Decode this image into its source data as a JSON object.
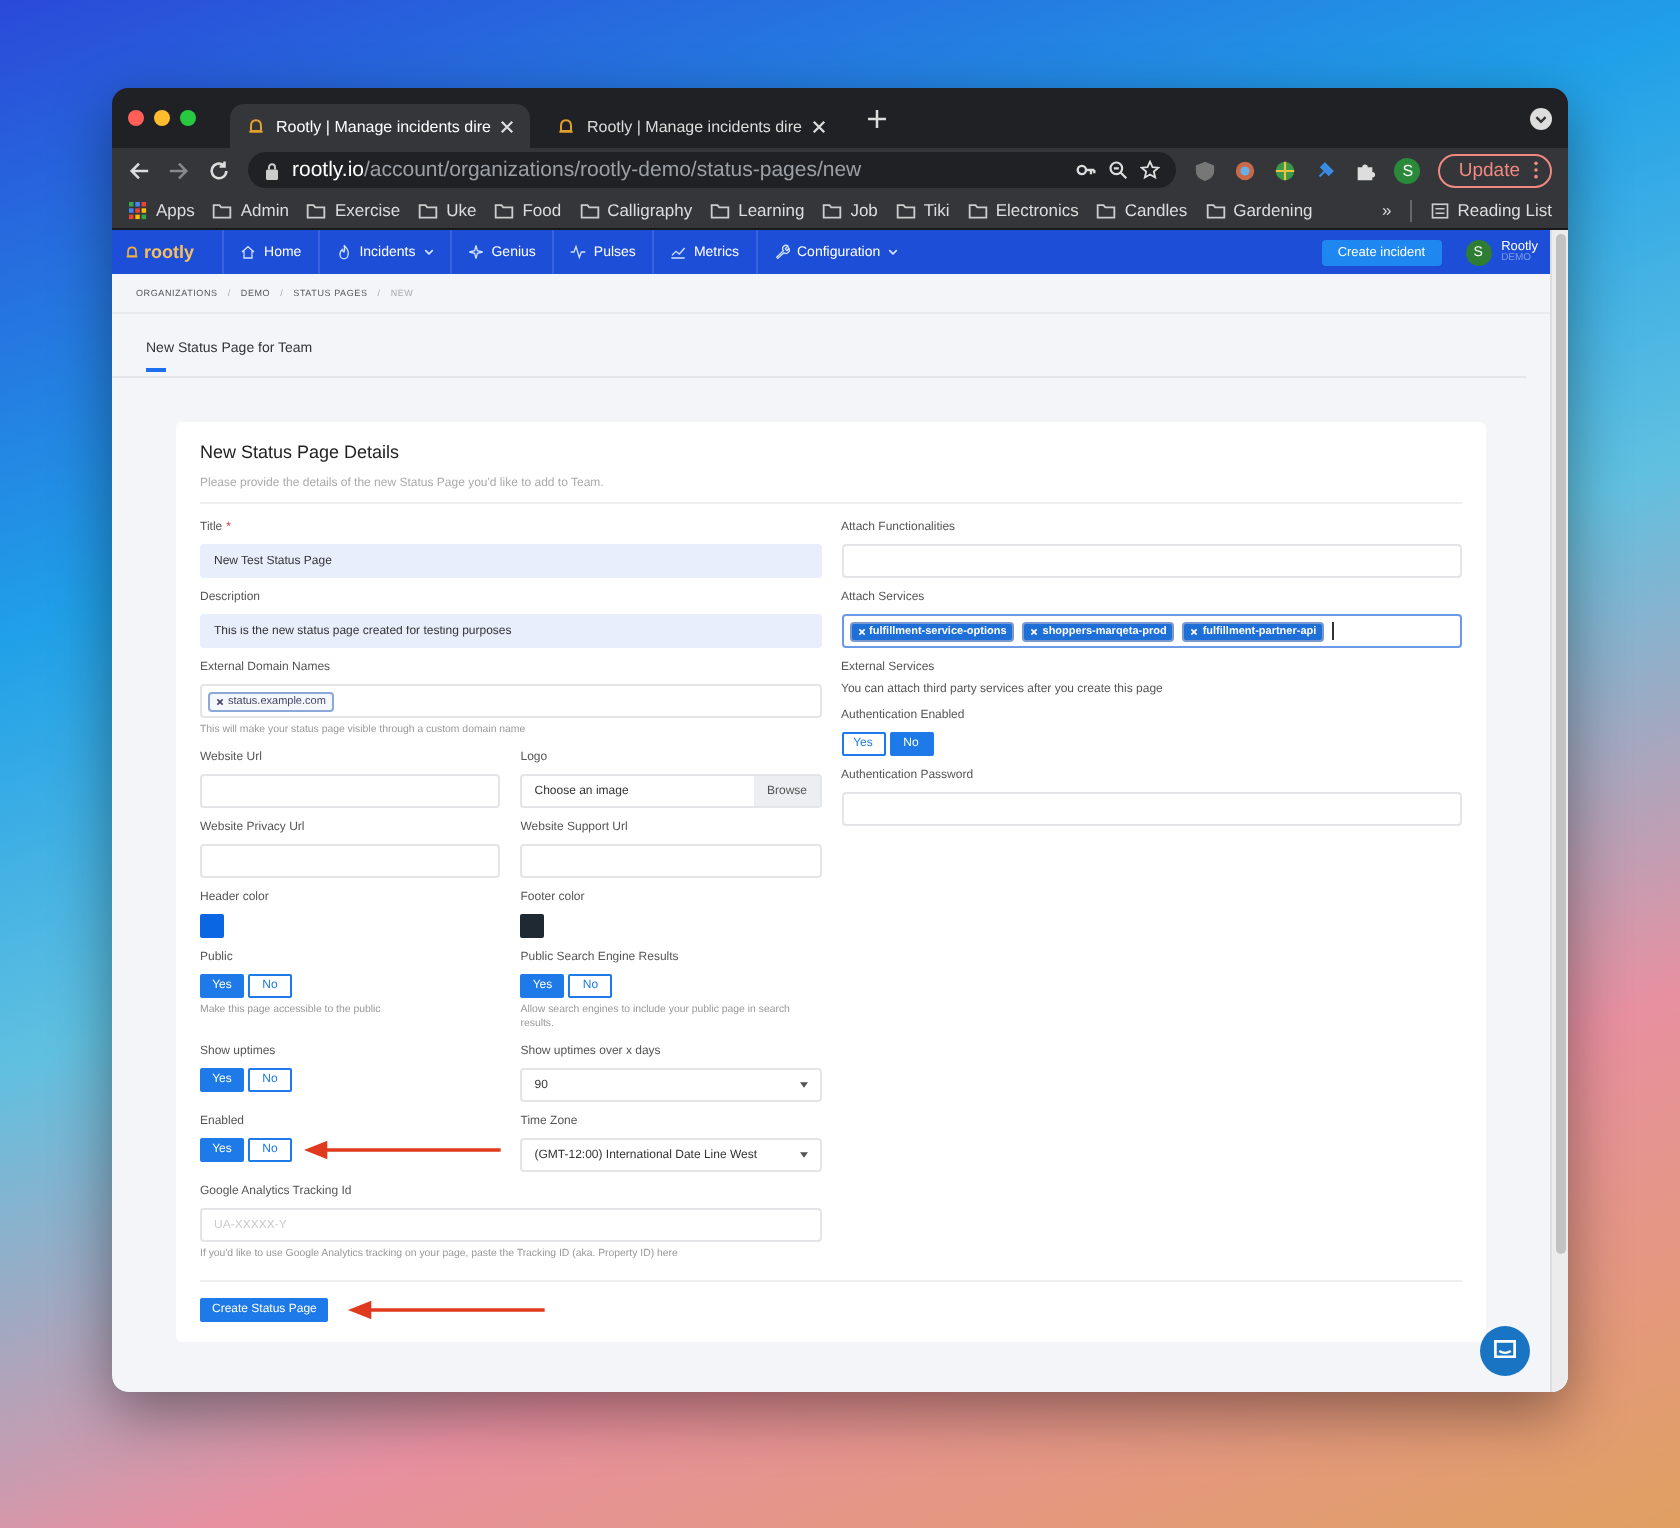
{
  "browser": {
    "tabs": [
      {
        "title": "Rootly | Manage incidents dire",
        "selected": true
      },
      {
        "title": "Rootly | Manage incidents dire",
        "selected": false
      }
    ],
    "url": {
      "host": "rootly.io",
      "path": "/account/organizations/rootly-demo/status-pages/new"
    },
    "profile_initial": "S",
    "update_button": "Update",
    "bookmarks": [
      {
        "kind": "apps",
        "label": "Apps"
      },
      {
        "kind": "folder",
        "label": "Admin"
      },
      {
        "kind": "folder",
        "label": "Exercise"
      },
      {
        "kind": "folder",
        "label": "Uke"
      },
      {
        "kind": "folder",
        "label": "Food"
      },
      {
        "kind": "folder",
        "label": "Calligraphy"
      },
      {
        "kind": "folder",
        "label": "Learning"
      },
      {
        "kind": "folder",
        "label": "Job"
      },
      {
        "kind": "folder",
        "label": "Tiki"
      },
      {
        "kind": "folder",
        "label": "Electronics"
      },
      {
        "kind": "folder",
        "label": "Candles"
      },
      {
        "kind": "folder",
        "label": "Gardening"
      }
    ],
    "more_bookmarks": "»",
    "reading_list": "Reading List"
  },
  "app": {
    "logo": "rootly",
    "nav": [
      {
        "label": "Home",
        "has_menu": false
      },
      {
        "label": "Incidents",
        "has_menu": true
      },
      {
        "label": "Genius",
        "has_menu": false
      },
      {
        "label": "Pulses",
        "has_menu": false
      },
      {
        "label": "Metrics",
        "has_menu": false
      },
      {
        "label": "Configuration",
        "has_menu": true
      }
    ],
    "create_button": "Create incident",
    "user": {
      "initial": "S",
      "name": "Rootly",
      "org": "DEMO"
    },
    "breadcrumbs": [
      "ORGANIZATIONS",
      "DEMO",
      "STATUS PAGES",
      "NEW"
    ],
    "breadcrumb_separator": "/",
    "page_tabs": [
      {
        "label": "New Status Page for Team",
        "selected": true
      }
    ],
    "card": {
      "title": "New Status Page Details",
      "subtitle": "Please provide the details of the new Status Page you'd like to add to Team.",
      "left": [
        {
          "fields": [
            {
              "kind": "text",
              "label": "Title",
              "required_mark": "*",
              "value": "New Test Status Page",
              "filled": true
            }
          ]
        },
        {
          "fields": [
            {
              "kind": "text",
              "label": "Description",
              "value": "This is the new status page created for testing purposes",
              "filled": true
            }
          ]
        },
        {
          "fields": [
            {
              "kind": "tags",
              "label": "External Domain Names",
              "tags": [
                {
                  "label": "status.example.com",
                  "selected": false
                }
              ],
              "focused": false,
              "help": "This will make your status page visible through a custom domain name"
            }
          ]
        },
        {
          "fields": [
            {
              "kind": "text",
              "label": "Website Url",
              "filled": false
            },
            {
              "kind": "file",
              "label": "Logo",
              "placeholder": "Choose an image",
              "button": "Browse"
            }
          ]
        },
        {
          "fields": [
            {
              "kind": "text",
              "label": "Website Privacy Url",
              "filled": false
            },
            {
              "kind": "text",
              "label": "Website Support Url",
              "filled": false
            }
          ]
        },
        {
          "fields": [
            {
              "kind": "color",
              "label": "Header color",
              "color": "#0b66e4"
            },
            {
              "kind": "color",
              "label": "Footer color",
              "color": "#1f2933"
            }
          ]
        },
        {
          "fields": [
            {
              "kind": "toggle",
              "label": "Public",
              "options": [
                {
                  "label": "Yes",
                  "selected": true
                },
                {
                  "label": "No",
                  "selected": false
                }
              ],
              "help": "Make this page accessible to the public"
            },
            {
              "kind": "toggle",
              "label": "Public Search Engine Results",
              "options": [
                {
                  "label": "Yes",
                  "selected": true
                },
                {
                  "label": "No",
                  "selected": false
                }
              ],
              "help": "Allow search engines to include your public page in search results."
            }
          ]
        },
        {
          "fields": [
            {
              "kind": "toggle",
              "label": "Show uptimes",
              "options": [
                {
                  "label": "Yes",
                  "selected": true
                },
                {
                  "label": "No",
                  "selected": false
                }
              ]
            },
            {
              "kind": "select",
              "label": "Show uptimes over x days",
              "value": "90"
            }
          ]
        },
        {
          "fields": [
            {
              "kind": "toggle",
              "label": "Enabled",
              "options": [
                {
                  "label": "Yes",
                  "selected": true
                },
                {
                  "label": "No",
                  "selected": false
                }
              ],
              "annotated": true
            },
            {
              "kind": "select",
              "label": "Time Zone",
              "value": "(GMT-12:00) International Date Line West"
            }
          ]
        },
        {
          "fields": [
            {
              "kind": "text",
              "label": "Google Analytics Tracking Id",
              "placeholder": "UA-XXXXX-Y",
              "filled": false,
              "help": "If you'd like to use Google Analytics tracking on your page, paste the Tracking ID (aka. Property ID) here"
            }
          ]
        }
      ],
      "right": [
        {
          "kind": "text",
          "label": "Attach Functionalities"
        },
        {
          "kind": "tags",
          "label": "Attach Services",
          "focused": true,
          "tags": [
            {
              "label": "fulfillment-service-options",
              "selected": true
            },
            {
              "label": "shoppers-marqeta-prod",
              "selected": true
            },
            {
              "label": "fulfillment-partner-api",
              "selected": true
            }
          ]
        },
        {
          "kind": "note",
          "label": "External Services",
          "text": "You can attach third party services after you create this page"
        },
        {
          "kind": "toggle",
          "label": "Authentication Enabled",
          "options": [
            {
              "label": "Yes",
              "selected": false
            },
            {
              "label": "No",
              "selected": true
            }
          ]
        },
        {
          "kind": "text",
          "label": "Authentication Password"
        }
      ],
      "submit": {
        "label": "Create Status Page",
        "annotated": true
      }
    }
  }
}
